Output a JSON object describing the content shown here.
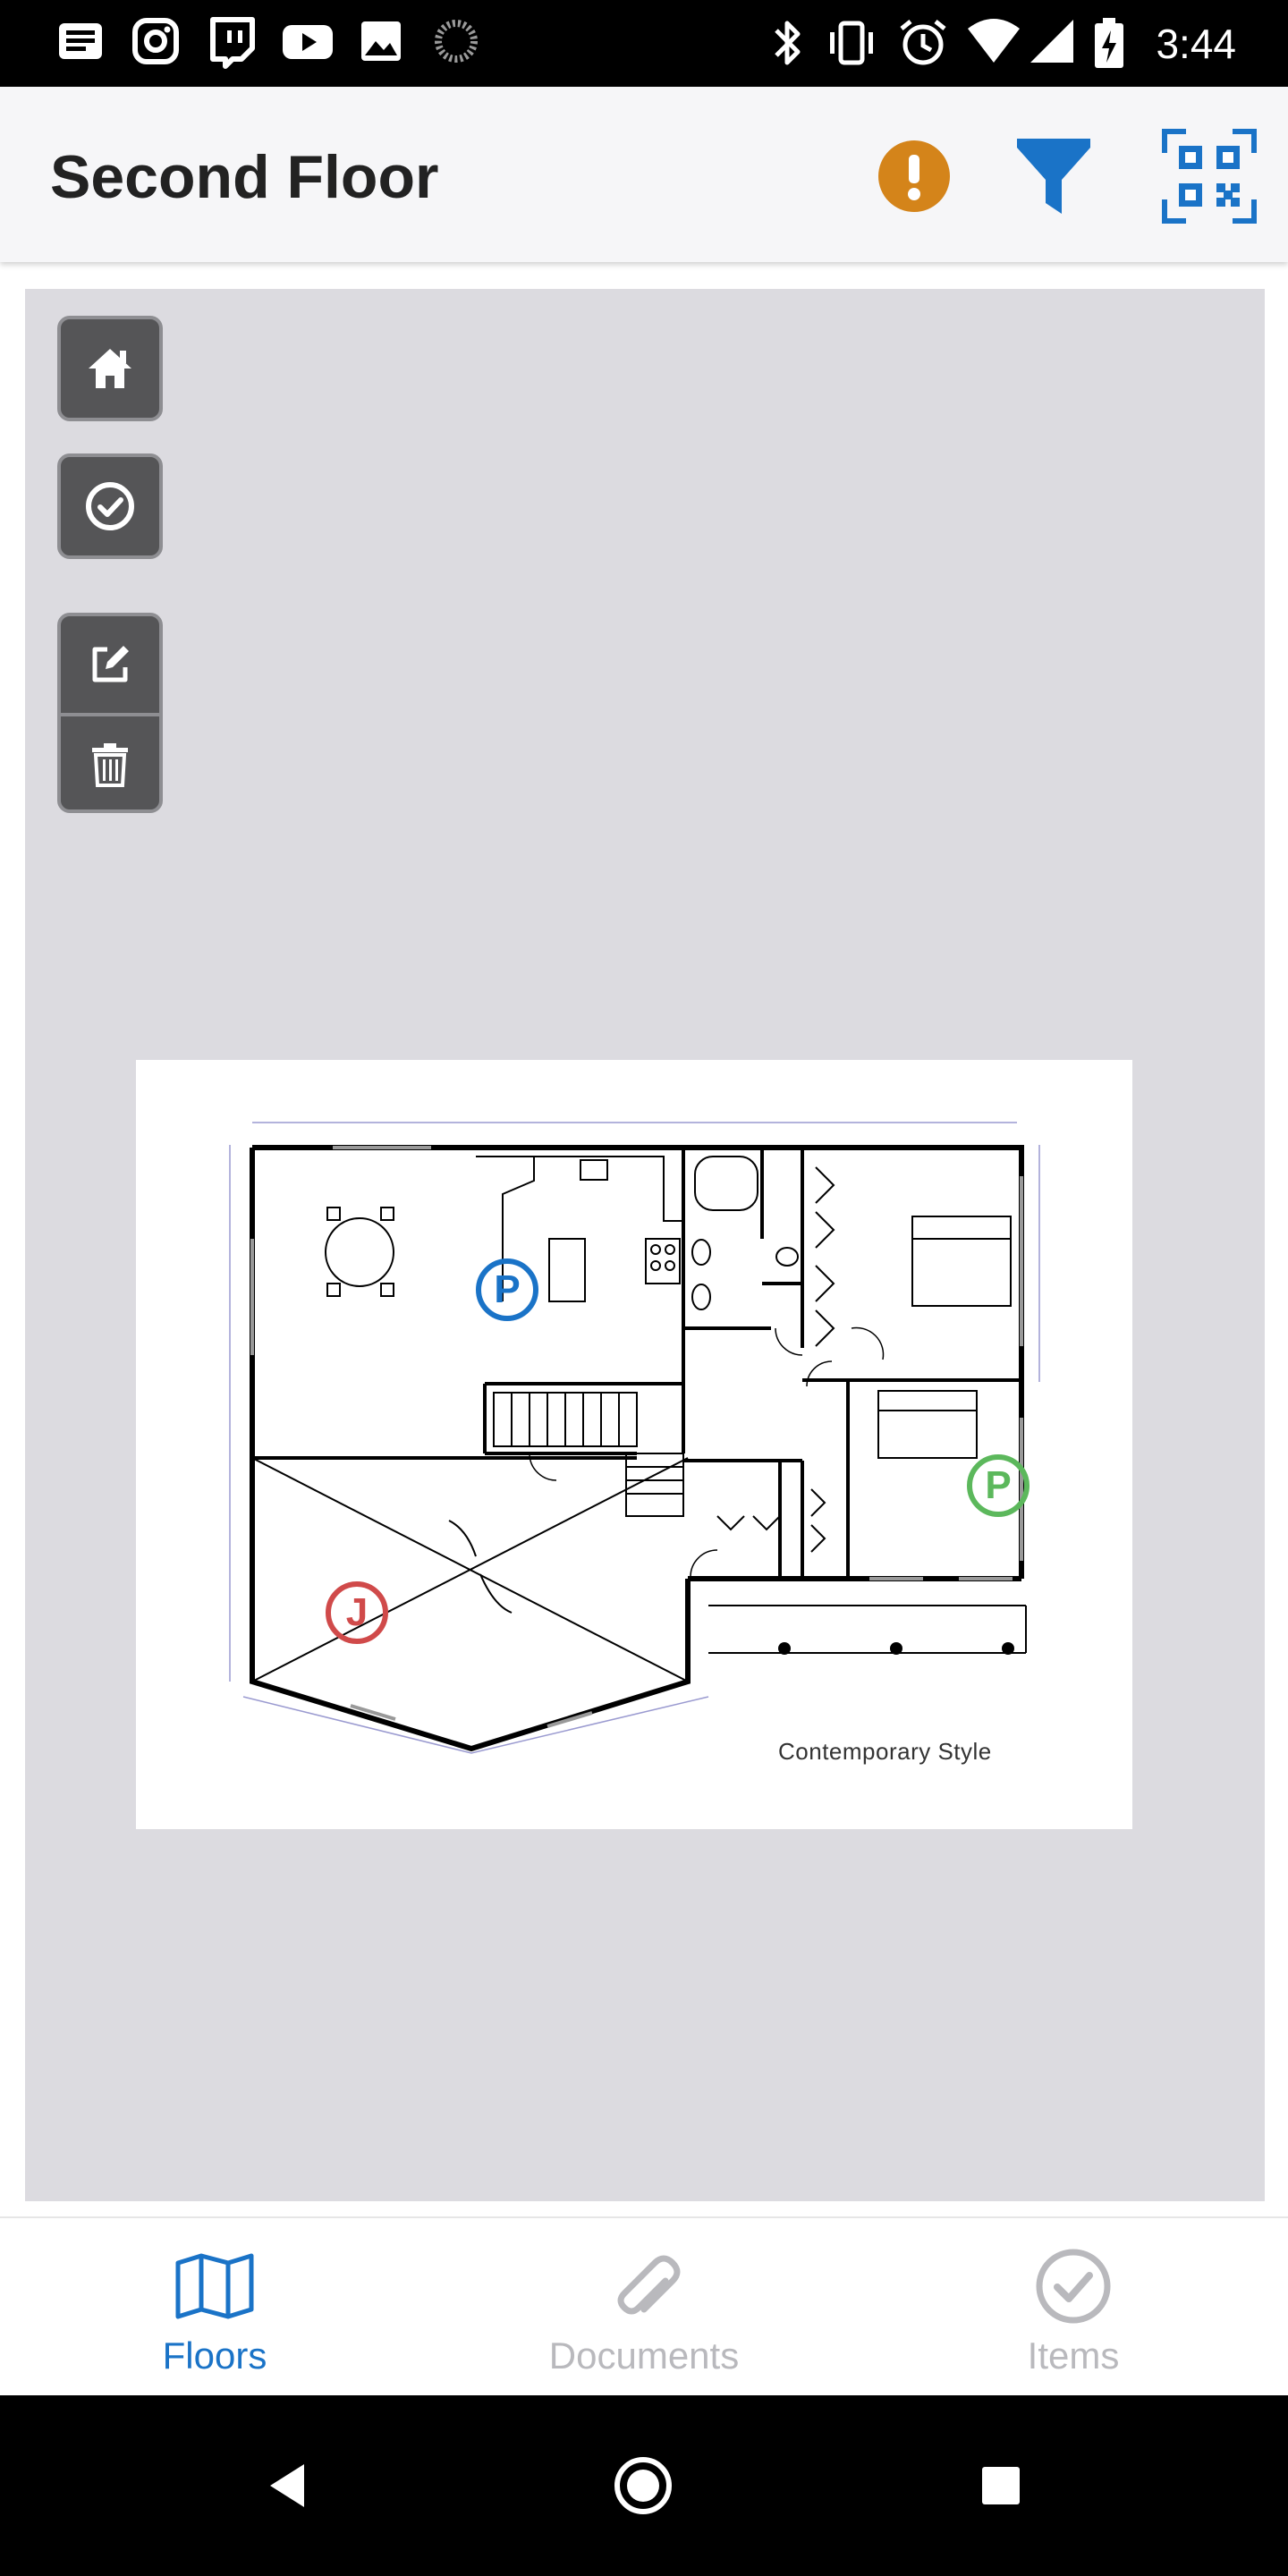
{
  "status_bar": {
    "time": "3:44",
    "icons": [
      "news-icon",
      "instagram-icon",
      "twitch-icon",
      "youtube-icon",
      "image-icon",
      "loading-icon",
      "bluetooth-icon",
      "vibrate-icon",
      "alarm-icon",
      "wifi-icon",
      "signal-icon",
      "battery-charging-icon"
    ]
  },
  "app_bar": {
    "title": "Second Floor",
    "actions": [
      "alert-icon",
      "filter-icon",
      "qr-code-icon"
    ],
    "colors": {
      "alert": "#d4841a",
      "accent": "#1a73c7"
    }
  },
  "map": {
    "tools": [
      "home-icon",
      "check-circle-icon",
      "edit-icon",
      "trash-icon"
    ],
    "plan_caption": "Contemporary Style",
    "pins": [
      {
        "label": "P",
        "color": "#1a73c7"
      },
      {
        "label": "P",
        "color": "#5cb85c"
      },
      {
        "label": "J",
        "color": "#d04a4a"
      }
    ]
  },
  "bottom_nav": {
    "items": [
      {
        "label": "Floors",
        "icon": "map-icon",
        "active": true
      },
      {
        "label": "Documents",
        "icon": "paperclip-icon",
        "active": false
      },
      {
        "label": "Items",
        "icon": "check-circle-icon",
        "active": false
      }
    ]
  }
}
